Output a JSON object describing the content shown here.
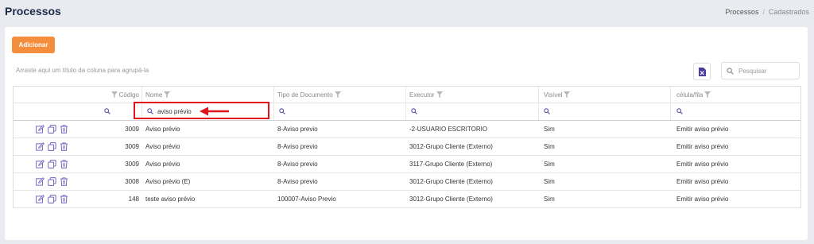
{
  "header": {
    "title": "Processos",
    "breadcrumb": [
      "Processos",
      "Cadastrados"
    ]
  },
  "toolbar": {
    "add_label": "Adicionar",
    "group_hint": "Arraste aqui um título da coluna para agrupá-la",
    "search_placeholder": "Pesquisar"
  },
  "columns": [
    "Código",
    "Nome",
    "Tipo de Documento",
    "Executor",
    "Visível",
    "célula/fila"
  ],
  "filters": {
    "nome": "aviso prévio"
  },
  "rows": [
    {
      "codigo": "3009",
      "nome": "Aviso prévio",
      "tipo": "8-Aviso previo",
      "executor": "-2-USUARIO ESCRITORIO",
      "visivel": "Sim",
      "celula": "Emitir aviso prévio"
    },
    {
      "codigo": "3009",
      "nome": "Aviso prévio",
      "tipo": "8-Aviso previo",
      "executor": "3012-Grupo Cliente (Externo)",
      "visivel": "Sim",
      "celula": "Emitir aviso prévio"
    },
    {
      "codigo": "3009",
      "nome": "Aviso prévio",
      "tipo": "8-Aviso previo",
      "executor": "3117-Grupo Cliente (Externo)",
      "visivel": "Sim",
      "celula": "Emitir aviso prévio"
    },
    {
      "codigo": "3008",
      "nome": "Aviso prévio (E)",
      "tipo": "8-Aviso previo",
      "executor": "3012-Grupo Cliente (Externo)",
      "visivel": "Sim",
      "celula": "Emitir aviso prévio"
    },
    {
      "codigo": "148",
      "nome": "teste aviso prévio",
      "tipo": "100007-Aviso Previo",
      "executor": "3012-Grupo Cliente (Externo)",
      "visivel": "Sim",
      "celula": "Emitir aviso prévio"
    }
  ],
  "colors": {
    "accent": "#f48d3c",
    "highlight": "#e0141b",
    "icon": "#6b5bb8"
  }
}
